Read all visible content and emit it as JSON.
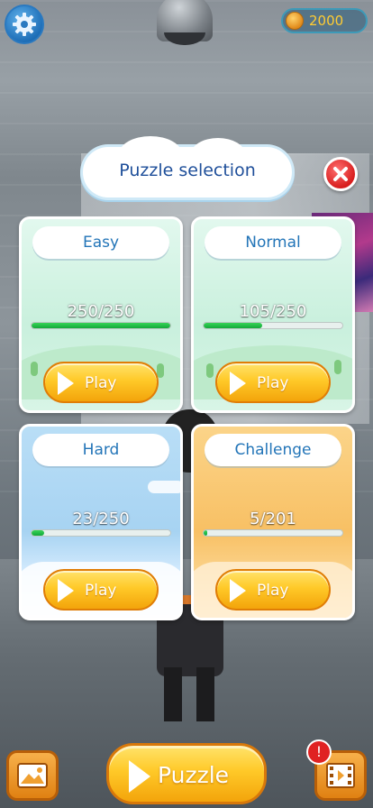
{
  "header": {
    "coins": "2000",
    "settings_icon": "gear-icon",
    "coin_icon": "coin-icon"
  },
  "dialog": {
    "title": "Puzzle selection",
    "close_icon": "close-icon"
  },
  "levels": [
    {
      "label": "Easy",
      "progress_text": "250/250",
      "progress_fraction": 1.0,
      "theme": "green",
      "play_label": "Play"
    },
    {
      "label": "Normal",
      "progress_text": "105/250",
      "progress_fraction": 0.42,
      "theme": "green",
      "play_label": "Play"
    },
    {
      "label": "Hard",
      "progress_text": "23/250",
      "progress_fraction": 0.092,
      "theme": "blue",
      "play_label": "Play"
    },
    {
      "label": "Challenge",
      "progress_text": "5/201",
      "progress_fraction": 0.025,
      "theme": "orange",
      "play_label": "Play"
    }
  ],
  "bottom_bar": {
    "gallery_icon": "image-gallery-icon",
    "puzzle_label": "Puzzle",
    "video_icon": "video-film-icon",
    "alert_badge": "!"
  },
  "colors": {
    "accent_blue": "#2375b8",
    "play_yellow": "#ffc928",
    "progress_green": "#12a83a",
    "close_red": "#d81e1e"
  }
}
